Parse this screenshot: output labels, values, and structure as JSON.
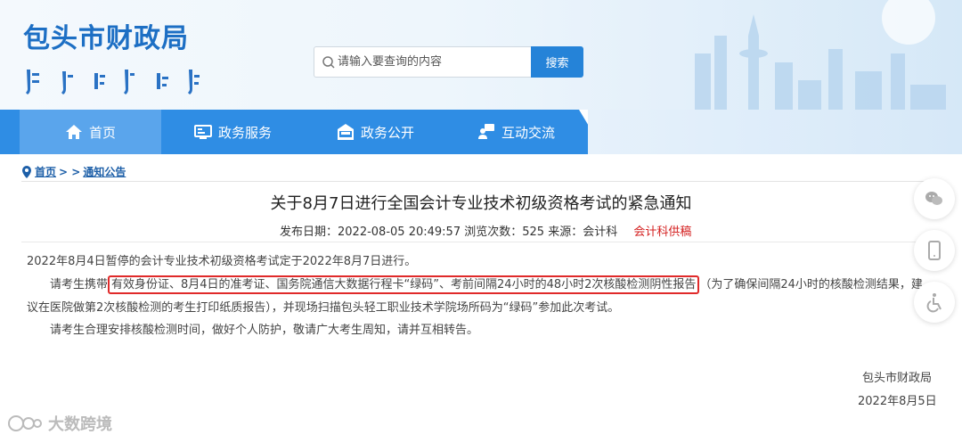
{
  "header": {
    "site_title": "包头市财政局",
    "search_placeholder": "请输入要查询的内容",
    "search_button": "搜索"
  },
  "nav": {
    "items": [
      {
        "label": "首页",
        "icon": "home-icon"
      },
      {
        "label": "政务服务",
        "icon": "monitor-icon"
      },
      {
        "label": "政务公开",
        "icon": "building-icon"
      },
      {
        "label": "互动交流",
        "icon": "chat-users-icon"
      }
    ]
  },
  "breadcrumb": {
    "home": "首页",
    "separator": "> >",
    "current": "通知公告"
  },
  "article": {
    "title": "关于8月7日进行全国会计专业技术初级资格考试的紧急通知",
    "meta": {
      "publish_label": "发布日期：",
      "publish_date": "2022-08-05 20:49:57",
      "views_label": "浏览次数：",
      "views": "525",
      "source_label": "来源：",
      "source": "会计科",
      "source_tag": "会计科供稿"
    },
    "p1": "2022年8月4日暂停的会计专业技术初级资格考试定于2022年8月7日进行。",
    "p2_lead": "请考生携带",
    "p2_highlight": "有效身份证、8月4日的准考证、国务院通信大数据行程卡“绿码”、考前间隔24小时的48小时2次核酸检测阴性报告",
    "p2_tail": "（为了确保间隔24小时的核酸检测结果，建",
    "p2_cont": "议在医院做第2次核酸检测的考生打印纸质报告），并现场扫描包头轻工职业技术学院场所码为“绿码”参加此次考试。",
    "p3": "请考生合理安排核酸检测时间，做好个人防护，敬请广大考生周知，请并互相转告。",
    "signature_org": "包头市财政局",
    "signature_date": "2022年8月5日"
  },
  "side_tools": [
    "wechat-icon",
    "mobile-icon",
    "accessibility-icon"
  ],
  "watermark": "大数跨境",
  "colors": {
    "brand_blue": "#1d6fc4",
    "nav_blue": "#2f8de4",
    "nav_active": "#5aa5ec",
    "highlight_red": "#e02a2a",
    "source_tag_red": "#d42020"
  }
}
